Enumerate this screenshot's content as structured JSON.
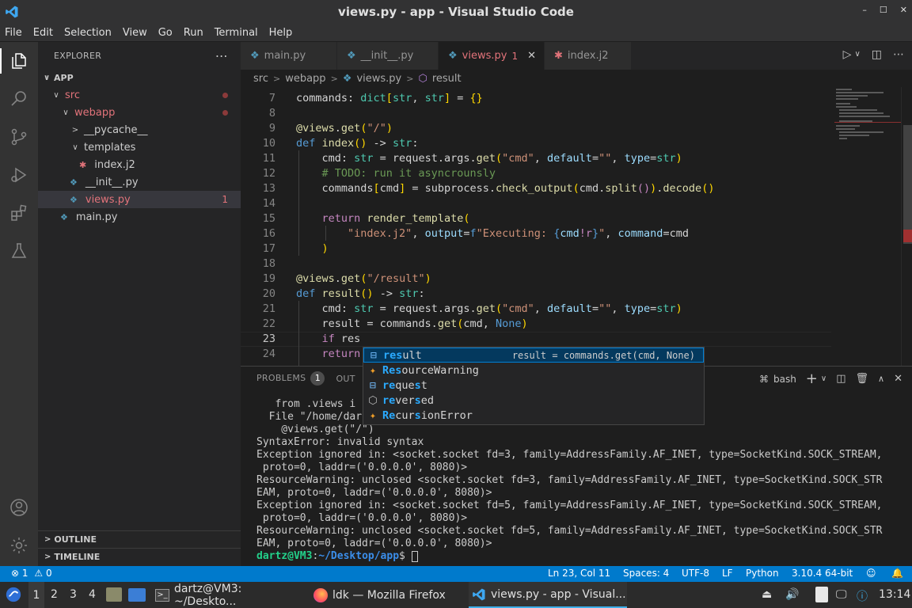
{
  "window": {
    "title": "views.py - app - Visual Studio Code",
    "controls": [
      "–",
      "☐",
      "✕"
    ]
  },
  "menu": [
    "File",
    "Edit",
    "Selection",
    "View",
    "Go",
    "Run",
    "Terminal",
    "Help"
  ],
  "sidebar": {
    "header": "EXPLORER",
    "more": "⋯",
    "root": "APP",
    "items": [
      {
        "label": "src",
        "indent": 1,
        "chev": "∨",
        "marker": "dot",
        "color": "red"
      },
      {
        "label": "webapp",
        "indent": 2,
        "chev": "∨",
        "marker": "dot",
        "color": "red"
      },
      {
        "label": "__pycache__",
        "indent": 3,
        "chev": ">",
        "marker": "",
        "color": ""
      },
      {
        "label": "templates",
        "indent": 3,
        "chev": "∨",
        "marker": "",
        "color": ""
      },
      {
        "label": "index.j2",
        "indent": 4,
        "chev": "",
        "marker": "",
        "color": "",
        "icon": "jinja"
      },
      {
        "label": "__init__.py",
        "indent": 3,
        "chev": "",
        "marker": "",
        "color": "",
        "icon": "python"
      },
      {
        "label": "views.py",
        "indent": 3,
        "chev": "",
        "marker": "count",
        "count": "1",
        "color": "red",
        "icon": "python",
        "selected": true
      },
      {
        "label": "main.py",
        "indent": 2,
        "chev": "",
        "marker": "",
        "color": "",
        "icon": "python"
      }
    ],
    "outline": "OUTLINE",
    "timeline": "TIMELINE"
  },
  "tabs": [
    {
      "label": "main.py",
      "icon": "python"
    },
    {
      "label": "__init__.py",
      "icon": "python"
    },
    {
      "label": "views.py",
      "icon": "python",
      "active": true,
      "badge": "1",
      "close": "✕"
    },
    {
      "label": "index.j2",
      "icon": "jinja"
    }
  ],
  "tab_actions": [
    "▷",
    "∨",
    "◫",
    "⋯"
  ],
  "breadcrumb": [
    "src",
    "webapp",
    "views.py",
    "result"
  ],
  "editor": {
    "line_numbers": [
      "7",
      "8",
      "9",
      "10",
      "11",
      "12",
      "13",
      "14",
      "15",
      "16",
      "17",
      "18",
      "19",
      "20",
      "21",
      "22",
      "23",
      "24"
    ],
    "current_line": "23"
  },
  "suggest": [
    {
      "label_hl": "res",
      "label_rest": "ult",
      "kind": "variable",
      "detail": "result = commands.get(cmd, None)",
      "selected": true
    },
    {
      "label_parts": [
        [
          "Res",
          "h"
        ],
        [
          "ourceWarning",
          ""
        ]
      ],
      "kind": "class"
    },
    {
      "label_parts": [
        [
          "re",
          "h"
        ],
        [
          "que",
          ""
        ],
        [
          "s",
          "h"
        ],
        [
          "t",
          ""
        ]
      ],
      "kind": "variable"
    },
    {
      "label_parts": [
        [
          "re",
          "h"
        ],
        [
          "ver",
          ""
        ],
        [
          "s",
          "h"
        ],
        [
          "ed",
          ""
        ]
      ],
      "kind": "module"
    },
    {
      "label_parts": [
        [
          "Re",
          "h"
        ],
        [
          "cur",
          ""
        ],
        [
          "s",
          "h"
        ],
        [
          "ionError",
          ""
        ]
      ],
      "kind": "class"
    }
  ],
  "panel": {
    "tabs": [
      "PROBLEMS",
      "OUT"
    ],
    "problems_count": "1",
    "shell": "bash",
    "terminal_lines": [
      "   from .views i",
      "  File \"/home/dar",
      "    @views.get(\"/\")",
      "SyntaxError: invalid syntax",
      "Exception ignored in: <socket.socket fd=3, family=AddressFamily.AF_INET, type=SocketKind.SOCK_STREAM,",
      " proto=0, laddr=('0.0.0.0', 8080)>",
      "ResourceWarning: unclosed <socket.socket fd=3, family=AddressFamily.AF_INET, type=SocketKind.SOCK_STR",
      "EAM, proto=0, laddr=('0.0.0.0', 8080)>",
      "Exception ignored in: <socket.socket fd=5, family=AddressFamily.AF_INET, type=SocketKind.SOCK_STREAM,",
      " proto=0, laddr=('0.0.0.0', 8080)>",
      "ResourceWarning: unclosed <socket.socket fd=5, family=AddressFamily.AF_INET, type=SocketKind.SOCK_STR",
      "EAM, proto=0, laddr=('0.0.0.0', 8080)>"
    ],
    "prompt_user": "dartz@VM3",
    "prompt_path": "~/Desktop/app",
    "prompt_suffix": "$ "
  },
  "status": {
    "errors": "1",
    "warnings": "0",
    "position": "Ln 23, Col 11",
    "spaces": "Spaces: 4",
    "encoding": "UTF-8",
    "eol": "LF",
    "language": "Python",
    "interpreter": "3.10.4 64-bit"
  },
  "taskbar": {
    "workspaces": [
      "1",
      "2",
      "3",
      "4"
    ],
    "windows": [
      {
        "label": "dartz@VM3: ~/Deskto...",
        "icon": "terminal"
      },
      {
        "label": "ldk — Mozilla Firefox",
        "icon": "firefox"
      },
      {
        "label": "views.py - app - Visual...",
        "icon": "vscode",
        "active": true
      }
    ],
    "clock": "13:14"
  },
  "colors": {
    "accent": "#007acc",
    "error": "#e2737a",
    "keyword": "#569cd6",
    "string": "#ce9178"
  }
}
